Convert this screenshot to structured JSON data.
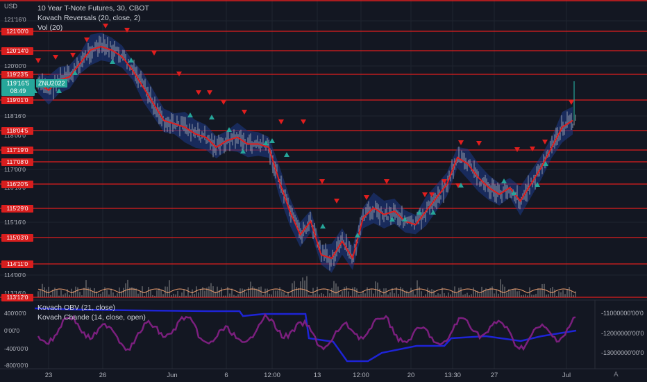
{
  "header": {
    "currency": "USD",
    "title": "10 Year T-Note Futures, 30, CBOT",
    "indicator1": "Kovach Reversals (20, close, 2)",
    "indicator2": "Vol (20)"
  },
  "lower_pane": {
    "indicator1": "Kovach OBV (21, close)",
    "indicator2": "Kovach Chande (14, close, open)"
  },
  "current_price": {
    "value": "119'16'5",
    "countdown": "08:49",
    "symbol": "ZNU2022"
  },
  "left_axis_labels": [
    "121'16'0",
    "120'00'0",
    "118'16'0",
    "118'00'0",
    "117'00'0",
    "116'16'0",
    "115'16'0",
    "114'00'0",
    "113'16'0"
  ],
  "level_tags": [
    "121'00'0",
    "120'14'0",
    "119'23'5",
    "119'01'0",
    "118'04'5",
    "117'19'0",
    "117'08'0",
    "116'20'5",
    "115'29'0",
    "115'03'0",
    "114'11'0",
    "113'12'0"
  ],
  "lower_left_labels": [
    "400'00'0",
    "0'00'0",
    "-400'00'0",
    "-800'00'0"
  ],
  "lower_right_labels": [
    "-11000000'00'0",
    "-12000000'00'0",
    "-13000000'00'0"
  ],
  "x_labels": [
    "23",
    "26",
    "Jun",
    "6",
    "12:00",
    "13",
    "12:00",
    "20",
    "13:30",
    "27",
    "Jul"
  ],
  "badge": "A",
  "colors": {
    "background": "#131722",
    "level_line": "#e01e1e",
    "price_line": "#e01e1e",
    "band": "#1e3a8a",
    "candle": "#b2b5be",
    "up_arrow": "#26a69a",
    "down_arrow": "#e01e1e",
    "obv": "#1e24d6",
    "chande": "#7b1f7e",
    "volume": "#a0a0a0",
    "volume_ma": "#f0a070"
  },
  "chart_data": {
    "type": "line",
    "title": "10 Year T-Note Futures, 30, CBOT",
    "x_labels": [
      "23",
      "26",
      "Jun",
      "6",
      "12:00",
      "13",
      "12:00",
      "20",
      "13:30",
      "27",
      "Jul"
    ],
    "series": [
      {
        "name": "Kovach Reversals (20, close, 2)",
        "values": [
          119.8,
          119.6,
          119.9,
          120.0,
          120.4,
          120.8,
          120.9,
          120.8,
          120.6,
          120.2,
          119.7,
          119.2,
          118.7,
          118.6,
          118.5,
          118.3,
          118.2,
          117.9,
          118.1,
          118.2,
          118.0,
          118.0,
          117.9,
          116.9,
          116.0,
          115.3,
          115.7,
          114.7,
          114.6,
          115.1,
          114.6,
          115.8,
          116.1,
          115.9,
          116.0,
          115.7,
          115.6,
          116.0,
          116.4,
          116.8,
          117.6,
          117.4,
          117.0,
          116.7,
          116.5,
          116.7,
          116.3,
          116.8,
          117.3,
          117.9,
          118.5,
          118.7
        ]
      }
    ],
    "volume_panel": "Vol (20)",
    "lower_series": [
      {
        "name": "Kovach OBV (21, close)"
      },
      {
        "name": "Kovach Chande (14, close, open)"
      }
    ]
  }
}
